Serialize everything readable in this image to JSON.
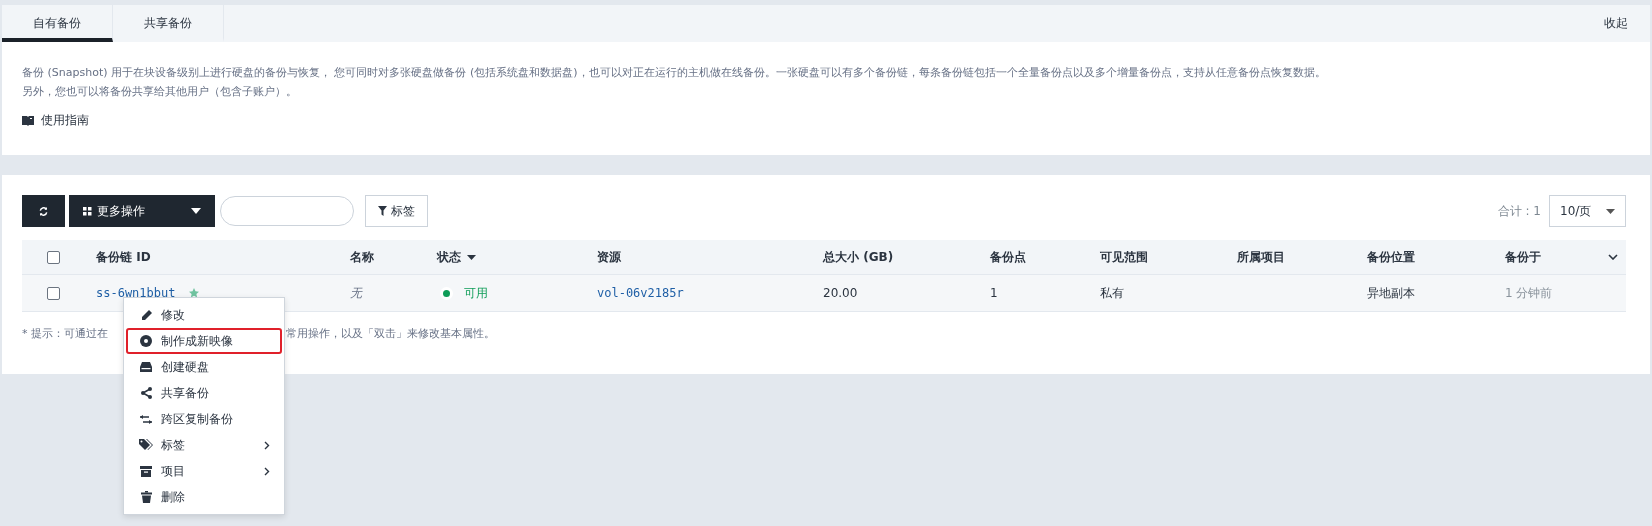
{
  "tabs": [
    {
      "label": "自有备份",
      "selected": true
    },
    {
      "label": "共享备份",
      "selected": false
    }
  ],
  "collapse_label": "收起",
  "intro": {
    "lines": [
      "备份 (Snapshot) 用于在块设备级别上进行硬盘的备份与恢复， 您可同时对多张硬盘做备份 (包括系统盘和数据盘)，也可以对正在运行的主机做在线备份。一张硬盘可以有多个备份链，每条备份链包括一个全量备份点以及多个增量备份点，支持从任意备份点恢复数据。",
      "另外，您也可以将备份共享给其他用户（包含子账户）。"
    ],
    "guide_link": "使用指南"
  },
  "toolbar": {
    "more_actions": "更多操作",
    "tag_button": "标签",
    "total": "合计 : 1",
    "page_size": "10/页"
  },
  "table": {
    "columns": [
      "备份链 ID",
      "名称",
      "状态",
      "资源",
      "总大小 (GB)",
      "备份点",
      "可见范围",
      "所属项目",
      "备份位置",
      "备份于"
    ],
    "rows": [
      {
        "checked": false,
        "id": "ss-6wn1bbut",
        "name": "无",
        "status": "可用",
        "resource": "vol-06v2185r",
        "size": "20.00",
        "points": "1",
        "scope": "私有",
        "project": "",
        "location": "异地副本",
        "time": "1 分钟前"
      }
    ],
    "header_checked": false
  },
  "hint": {
    "before": "* 提示：可通过在",
    "after": "常用操作，以及「双击」来修改基本属性。"
  },
  "context_menu": [
    {
      "kind": "edit",
      "label": "修改",
      "submenu": false,
      "highlighted": false
    },
    {
      "kind": "image",
      "label": "制作成新映像",
      "submenu": false,
      "highlighted": true
    },
    {
      "kind": "disk",
      "label": "创建硬盘",
      "submenu": false,
      "highlighted": false
    },
    {
      "kind": "share",
      "label": "共享备份",
      "submenu": false,
      "highlighted": false
    },
    {
      "kind": "copy",
      "label": "跨区复制备份",
      "submenu": false,
      "highlighted": false
    },
    {
      "kind": "tag",
      "label": "标签",
      "submenu": true,
      "highlighted": false
    },
    {
      "kind": "project",
      "label": "项目",
      "submenu": true,
      "highlighted": false
    },
    {
      "kind": "delete",
      "label": "删除",
      "submenu": false,
      "highlighted": false
    }
  ]
}
